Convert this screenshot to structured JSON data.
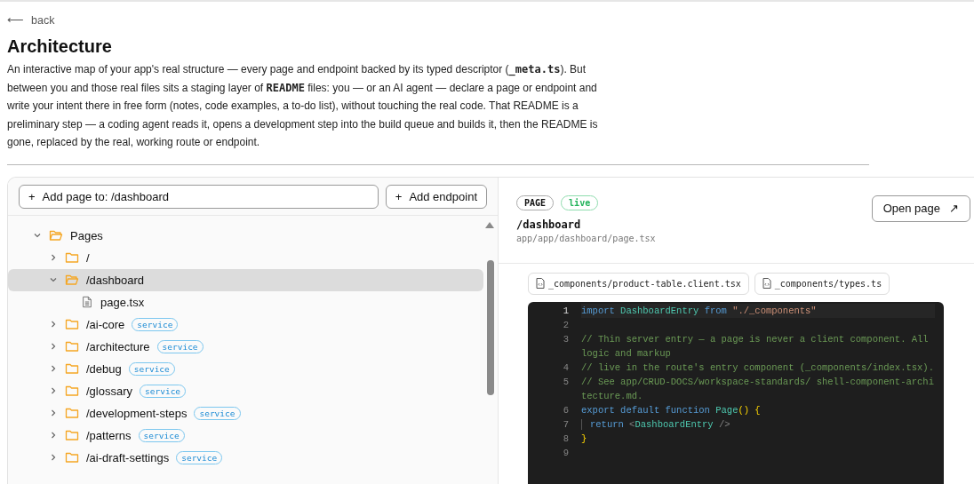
{
  "back": {
    "icon": "⟵",
    "label": "back"
  },
  "title": "Architecture",
  "description": [
    {
      "kind": "plain",
      "text": "An interactive map of your app's real structure — every page and endpoint backed by its typed descriptor ("
    },
    {
      "kind": "code",
      "text": "_meta.ts"
    },
    {
      "kind": "plain",
      "text": "). But between you and those real files sits a staging layer of "
    },
    {
      "kind": "code",
      "text": "README"
    },
    {
      "kind": "plain",
      "text": " files: you — or an AI agent — declare a page or endpoint and write your intent there in free form (notes, code examples, a to-do list), without touching the real code. That README is a preliminary step — a coding agent reads it, opens a development step into the build queue and builds it, then the README is gone, replaced by the real, working route or endpoint."
    }
  ],
  "toolbar": [
    {
      "icon": "+",
      "label": "Add page to: /dashboard",
      "kind": "wide"
    },
    {
      "icon": "+",
      "label": "Add endpoint",
      "kind": "normal"
    }
  ],
  "tree": [
    {
      "label": "Pages",
      "kind": "folder",
      "expanded": true,
      "selected": false,
      "children": [
        {
          "label": "/",
          "kind": "folder",
          "expanded": false,
          "selected": false
        },
        {
          "label": "/dashboard",
          "kind": "folder",
          "expanded": true,
          "selected": true,
          "children": [
            {
              "label": "page.tsx",
              "kind": "file",
              "selected": false
            }
          ]
        },
        {
          "label": "/ai-core",
          "kind": "folder",
          "expanded": false,
          "selected": false,
          "badge": "service"
        },
        {
          "label": "/architecture",
          "kind": "folder",
          "expanded": false,
          "selected": false,
          "badge": "service"
        },
        {
          "label": "/debug",
          "kind": "folder",
          "expanded": false,
          "selected": false,
          "badge": "service"
        },
        {
          "label": "/glossary",
          "kind": "folder",
          "expanded": false,
          "selected": false,
          "badge": "service"
        },
        {
          "label": "/development-steps",
          "kind": "folder",
          "expanded": false,
          "selected": false,
          "badge": "service"
        },
        {
          "label": "/patterns",
          "kind": "folder",
          "expanded": false,
          "selected": false,
          "badge": "service"
        },
        {
          "label": "/ai-draft-settings",
          "kind": "folder",
          "expanded": false,
          "selected": false,
          "badge": "service"
        }
      ]
    }
  ],
  "detail": {
    "type_badge": "PAGE",
    "status_badge": "live",
    "route": "/dashboard",
    "path": "app/app/dashboard/page.tsx",
    "open_button": {
      "label": "Open page",
      "icon": "↗"
    },
    "files": [
      "_components/product-table.client.tsx",
      "_components/types.ts"
    ],
    "code": [
      {
        "n": "1",
        "active": true,
        "tokens": [
          {
            "kind": "keyword",
            "text": "import "
          },
          {
            "kind": "identifier",
            "text": "DashboardEntry "
          },
          {
            "kind": "keyword",
            "text": "from "
          },
          {
            "kind": "string",
            "text": "\"./_components\""
          }
        ]
      },
      {
        "n": "2",
        "active": false
      },
      {
        "n": "3",
        "active": false,
        "tokens": [
          {
            "kind": "comment",
            "text": "// Thin server entry — a page is never a client component. All logic and markup"
          }
        ]
      },
      {
        "n": "4",
        "active": false,
        "tokens": [
          {
            "kind": "comment",
            "text": "// live in the route's entry component (_components/index.tsx)."
          }
        ]
      },
      {
        "n": "5",
        "active": false,
        "tokens": [
          {
            "kind": "comment",
            "text": "// See app/CRUD-DOCS/workspace-standards/ shell-component-architecture.md."
          }
        ]
      },
      {
        "n": "6",
        "active": false,
        "tokens": [
          {
            "kind": "keyword",
            "text": "export default function "
          },
          {
            "kind": "identifier",
            "text": "Page"
          },
          {
            "kind": "bracket",
            "text": "() {"
          }
        ]
      },
      {
        "n": "7",
        "active": false,
        "indent": true,
        "tokens": [
          {
            "kind": "keyword",
            "text": "return "
          },
          {
            "kind": "punct",
            "text": "<"
          },
          {
            "kind": "identifier",
            "text": "DashboardEntry"
          },
          {
            "kind": "punct",
            "text": " />"
          }
        ]
      },
      {
        "n": "8",
        "active": false,
        "tokens": [
          {
            "kind": "bracket",
            "text": "}"
          }
        ]
      },
      {
        "n": "9",
        "active": false
      }
    ]
  }
}
